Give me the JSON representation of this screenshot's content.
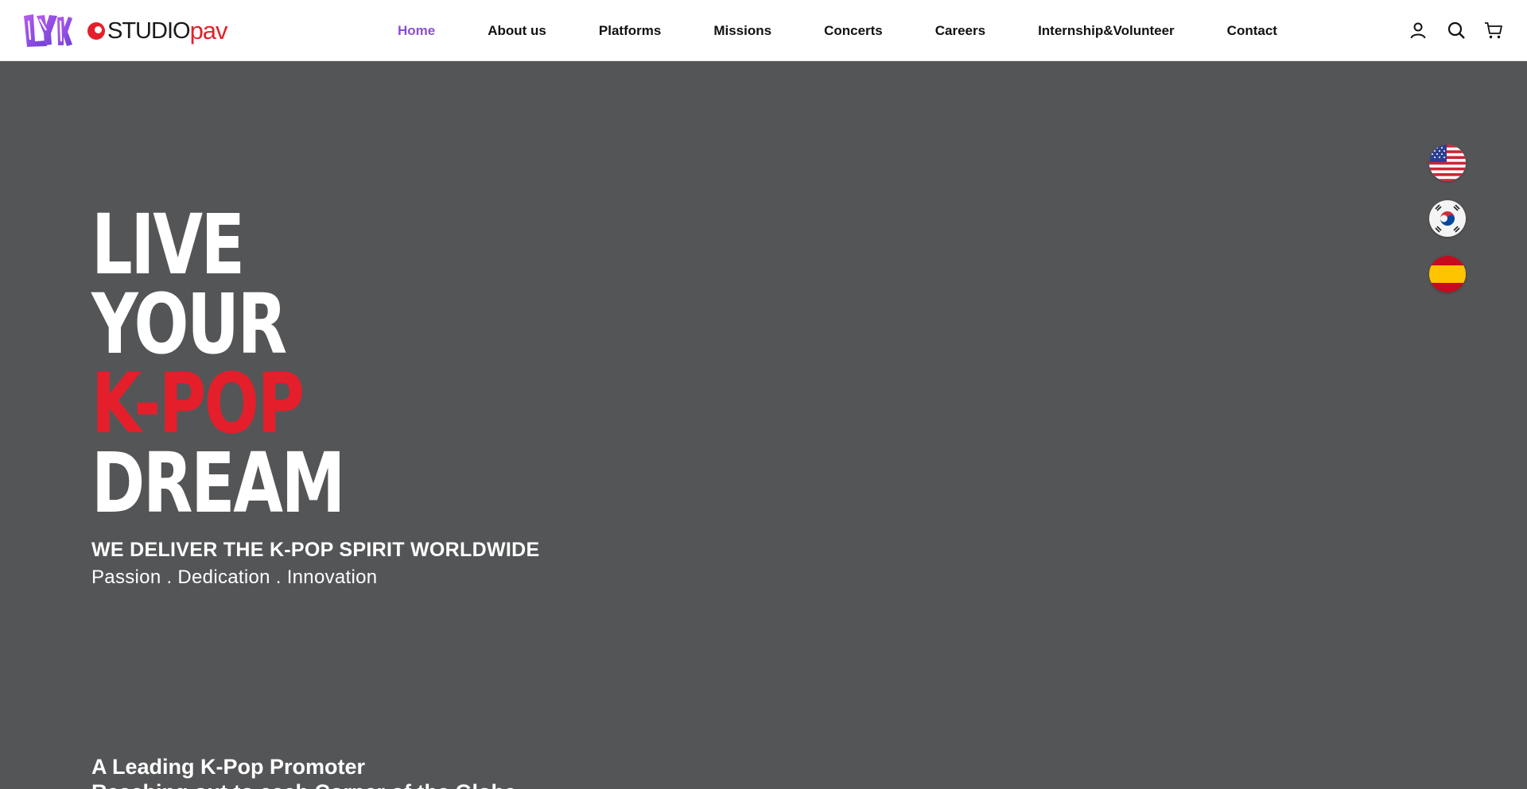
{
  "brand": {
    "lyko_logo": "LYKO!",
    "studio_text": "STUDIO",
    "pav_text": "pav",
    "colors": {
      "purple": "#8a4fd1",
      "red": "#e41f2b",
      "hero_bg": "#545557"
    }
  },
  "nav": {
    "items": [
      {
        "label": "Home",
        "active": true
      },
      {
        "label": "About us"
      },
      {
        "label": "Platforms"
      },
      {
        "label": "Missions"
      },
      {
        "label": "Concerts"
      },
      {
        "label": "Careers"
      },
      {
        "label": "Internship&Volunteer"
      },
      {
        "label": "Contact"
      }
    ]
  },
  "header_icons": [
    "user-icon",
    "search-icon",
    "cart-icon"
  ],
  "languages": [
    "us-flag-icon",
    "korea-flag-icon",
    "spain-flag-icon"
  ],
  "hero": {
    "line1": "LIVE",
    "line2": "YOUR",
    "line3": "K-POP",
    "line4": "DREAM",
    "tagline": "WE DELIVER THE K-POP SPIRIT WORLDWIDE",
    "subtagline": "Passion . Dedication . Innovation"
  },
  "promo": {
    "line1": "A Leading K-Pop Promoter",
    "line2": "Reaching out to each Corner of the Globe"
  }
}
